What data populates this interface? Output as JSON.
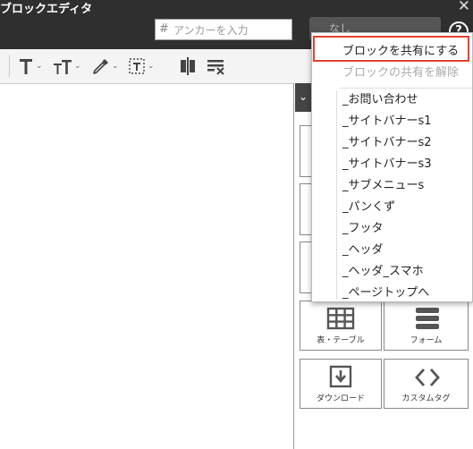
{
  "window": {
    "title": "ブロックエディタ",
    "close_glyph": "✕"
  },
  "header": {
    "anchor": {
      "prefix": "#",
      "placeholder": "アンカーを入力",
      "value": ""
    },
    "share_select": {
      "value": "なし"
    },
    "help_glyph": "?"
  },
  "toolbar": {
    "tools": [
      "text-size-icon",
      "text-case-icon",
      "eyedropper-icon",
      "select-box-icon",
      "split-column-icon",
      "remove-format-icon"
    ]
  },
  "block_panel": {
    "toggle_glyph": "⌄",
    "tiles": [
      {
        "label": "表・テーブル",
        "icon": "table-icon"
      },
      {
        "label": "フォーム",
        "icon": "form-icon"
      },
      {
        "label": "ダウンロード",
        "icon": "download-icon"
      },
      {
        "label": "カスタムタグ",
        "icon": "code-icon"
      }
    ]
  },
  "share_menu": {
    "actions": [
      {
        "label": "ブロックを共有にする",
        "enabled": true,
        "highlighted": true
      },
      {
        "label": "ブロックの共有を解除",
        "enabled": false
      }
    ],
    "shared_blocks": [
      "_お問い合わせ",
      "_サイトバナーs1",
      "_サイトバナーs2",
      "_サイトバナーs3",
      "_サブメニューs",
      "_パンくず",
      "_フッタ",
      "_ヘッダ",
      "_ヘッダ_スマホ",
      "_ページトップへ"
    ]
  }
}
